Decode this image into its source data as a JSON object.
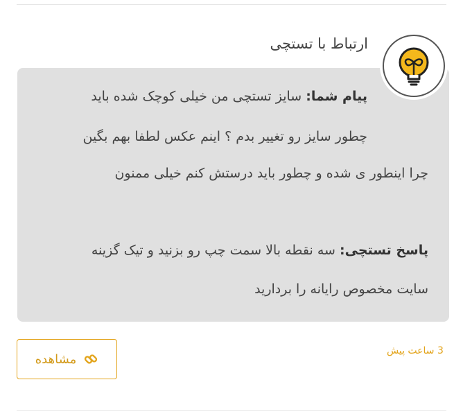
{
  "header": {
    "title": "ارتباط با تستچی"
  },
  "avatar": {
    "icon": "lightbulb-icon"
  },
  "message": {
    "user_label": "پیام شما:",
    "user_line1": "سایز تستچی من خیلی کوچک شده باید",
    "user_line2": "چطور سایز رو تغییر بدم ؟ اینم عکس لطفا بهم بگین",
    "user_line3": "چرا اینطور ی شده و چطور باید درستش کنم خیلی ممنون",
    "reply_label": "پاسخ تستچی:",
    "reply_line1": "سه نقطه بالا سمت چپ رو بزنید و تیک گزینه",
    "reply_line2": "سایت مخصوص رایانه را بردارید"
  },
  "footer": {
    "time": "3 ساعت پیش",
    "view_label": "مشاهده",
    "view_icon": "link-icon"
  },
  "colors": {
    "accent": "#e3a41b",
    "bubble": "#e0e0e0",
    "bulb": "#f4b81c"
  }
}
